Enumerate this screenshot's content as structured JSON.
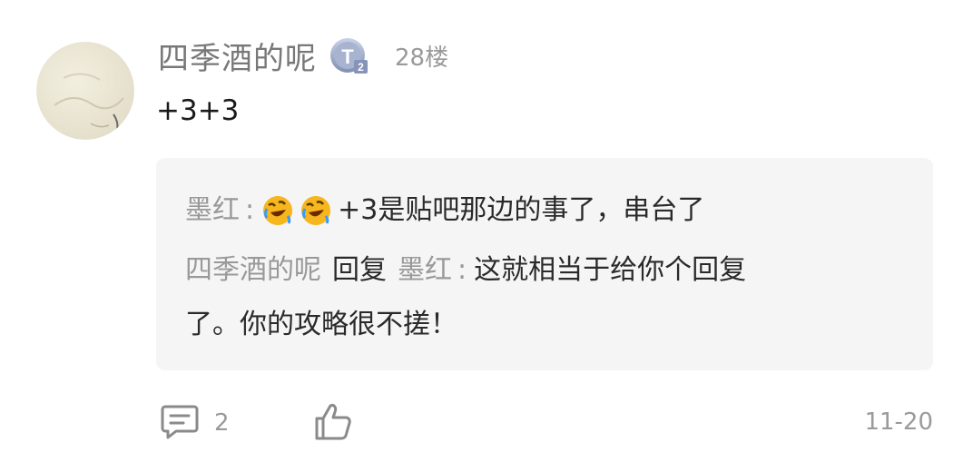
{
  "comment": {
    "username": "四季酒的呢",
    "level_badge_icon": "tieba-level-badge-icon",
    "floor": "28楼",
    "content": "+3+3",
    "replies": [
      {
        "author": "墨红",
        "emoji": [
          "laughing-crying-emoji-icon",
          "laughing-crying-emoji-icon"
        ],
        "text": "+3是贴吧那边的事了，串台了"
      },
      {
        "author": "四季酒的呢",
        "reply_word": "回复",
        "reply_to": "墨红",
        "text_line1": "这就相当于给你个回复",
        "text_line2": "了。你的攻略很不搓！"
      }
    ],
    "footer": {
      "comment_count": "2",
      "date": "11-20"
    }
  },
  "colors": {
    "name_gray": "#787878",
    "reply_box_bg": "#f5f5f5",
    "emoji_yellow": "#f7b51e"
  }
}
